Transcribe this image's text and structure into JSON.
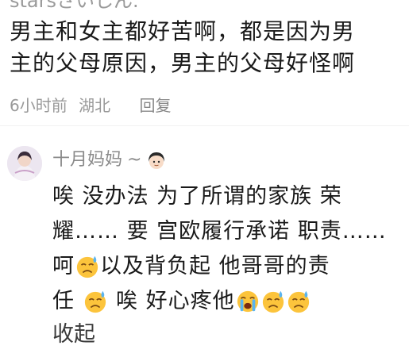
{
  "fragment_top": "starsさいしん.",
  "comment1": {
    "lines": [
      "男主和女主都好苦啊，都是因为男",
      "主的父母原因，男主的父母好怪啊"
    ],
    "time": "6小时前",
    "location": "湖北",
    "reply_label": "回复"
  },
  "comment2": {
    "username": "十月妈妈",
    "tilde": "~",
    "username_emoji": "girl-emoji",
    "line1": "唉 没办法 为了所谓的家族 荣",
    "line2": "耀…… 要 宫欧履行承诺 职责……",
    "line3_a": "呵",
    "line3_b": "以及背负起 他哥哥的责",
    "line4_a": "任",
    "line4_b": "唉 好心疼他",
    "emoji_names": [
      "sweat-sad-emoji",
      "loudly-crying-emoji"
    ],
    "collapse_label": "收起"
  },
  "colors": {
    "text": "#1a1a1a",
    "meta": "#999999",
    "emoji_face": "#fcc43c",
    "tear": "#5ab4f0"
  }
}
